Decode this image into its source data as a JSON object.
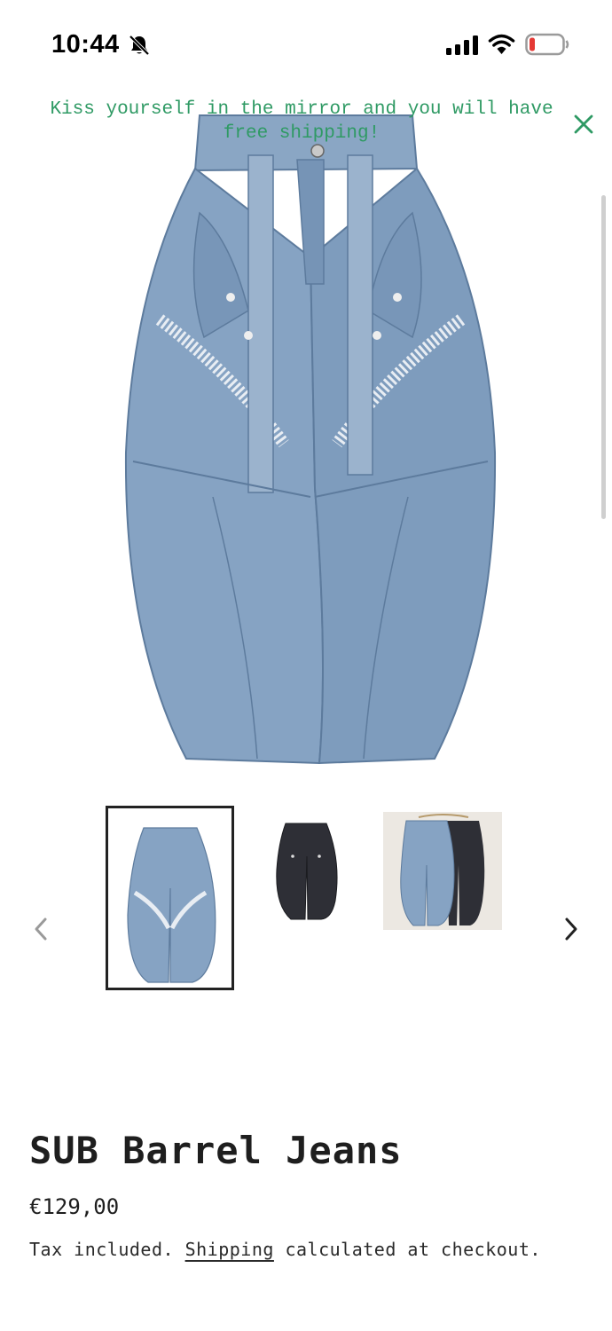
{
  "status_bar": {
    "time": "10:44",
    "icons": [
      "bell-slash-icon",
      "cellular-signal-icon",
      "wifi-icon",
      "battery-low-icon"
    ]
  },
  "announcement": {
    "text": "Kiss yourself in the mirror and you will have free shipping!",
    "close_icon": "close-icon",
    "color": "#2f9a64"
  },
  "product": {
    "title": "SUB Barrel Jeans",
    "price": "€129,00",
    "tax_prefix": "Tax included.",
    "shipping_link": "Shipping",
    "tax_suffix": "calculated at checkout."
  },
  "gallery": {
    "prev_icon": "chevron-left-icon",
    "next_icon": "chevron-right-icon",
    "thumbnails": [
      {
        "variant": "light-blue",
        "selected": true
      },
      {
        "variant": "black",
        "selected": false
      },
      {
        "variant": "light-blue-and-black",
        "selected": false
      }
    ]
  },
  "colors": {
    "denim": "#7f9dbd",
    "denim_dark": "#5f7fa3",
    "black_denim": "#2e2f36",
    "text": "#1e1e1e"
  }
}
